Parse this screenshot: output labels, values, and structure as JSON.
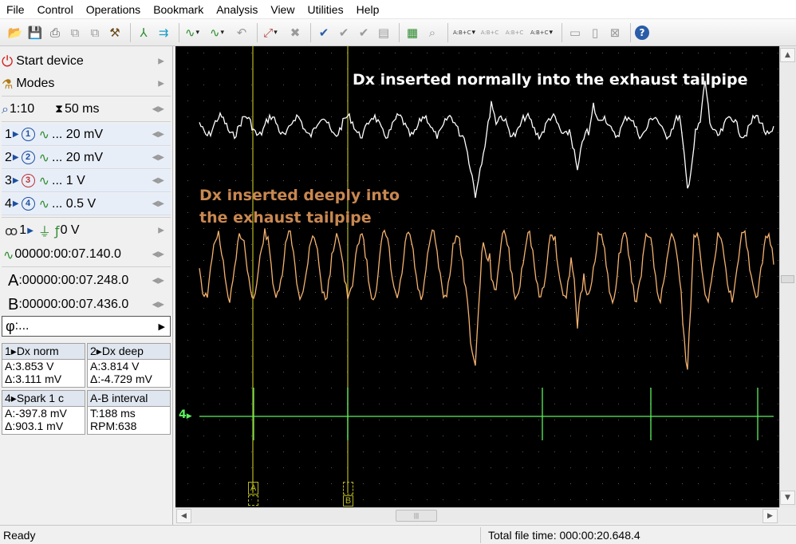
{
  "menu": [
    "File",
    "Control",
    "Operations",
    "Bookmark",
    "Analysis",
    "View",
    "Utilities",
    "Help"
  ],
  "toolbar": {
    "icons": [
      "open-icon",
      "save-icon",
      "print-icon",
      "copy-icon",
      "paste-icon",
      "tool-icon",
      "cursor-icon",
      "marker-icon",
      "channel-wave-icon",
      "measure-icon",
      "undo-icon",
      "zoom-icon",
      "delete-icon",
      "check-icon",
      "check2-icon",
      "check3-icon",
      "page-icon",
      "grid-icon",
      "search-icon",
      "abc-icon",
      "abc2-icon",
      "abc3-icon",
      "abc-run-icon",
      "monitor-icon",
      "doc-icon",
      "cross-icon",
      "help-icon"
    ],
    "abc_label": "A:B+C"
  },
  "left_panel": {
    "start_device": "Start device",
    "modes": "Modes",
    "zoom": "1:10",
    "timebase": "50 ms",
    "channels": [
      {
        "num": "1",
        "circle": "1",
        "value": "... 20 mV",
        "enabled": true
      },
      {
        "num": "2",
        "circle": "2",
        "value": "... 20 mV",
        "enabled": true
      },
      {
        "num": "3",
        "circle": "3",
        "value": "... 1 V",
        "enabled": false
      },
      {
        "num": "4",
        "circle": "4",
        "value": "... 0.5 V",
        "enabled": true
      }
    ],
    "trigger": {
      "channel": "1",
      "level": "0 V"
    },
    "trigger_time": "00000:00:07.140.0",
    "cursor_a": {
      "label": "A",
      "value": ":00000:00:07.248.0"
    },
    "cursor_b": {
      "label": "B",
      "value": ":00000:00:07.436.0"
    },
    "phase": {
      "label": "φ",
      "value": ":..."
    },
    "measurements": [
      {
        "title": "1▸Dx norm",
        "line1": "A:3.853 V",
        "line2": "Δ:3.111 mV"
      },
      {
        "title": "2▸Dx deep",
        "line1": "A:3.814 V",
        "line2": "Δ:-4.729 mV"
      },
      {
        "title": "4▸Spark 1 c",
        "line1": "A:-397.8 mV",
        "line2": "Δ:903.1 mV"
      },
      {
        "title": "A-B interval",
        "line1": "T:188 ms",
        "line2": "RPM:638"
      }
    ]
  },
  "scope": {
    "annotation_white": "Dx inserted normally into the exhaust tailpipe",
    "annotation_orange_line1": "Dx inserted deeply into",
    "annotation_orange_line2": "the exhaust tailpipe",
    "channel4_marker": "4",
    "cursor_a_label": "A",
    "cursor_b_label": "B",
    "colors": {
      "white_trace": "#ffffff",
      "orange_trace": "#f5b26e",
      "green_trace": "#5cf05c",
      "cursor": "#b8b820",
      "grid": "#5a5a5a",
      "annot_orange": "#c98850"
    }
  },
  "status": {
    "ready": "Ready",
    "total_time": "Total file time: 000:00:20.648.4"
  }
}
